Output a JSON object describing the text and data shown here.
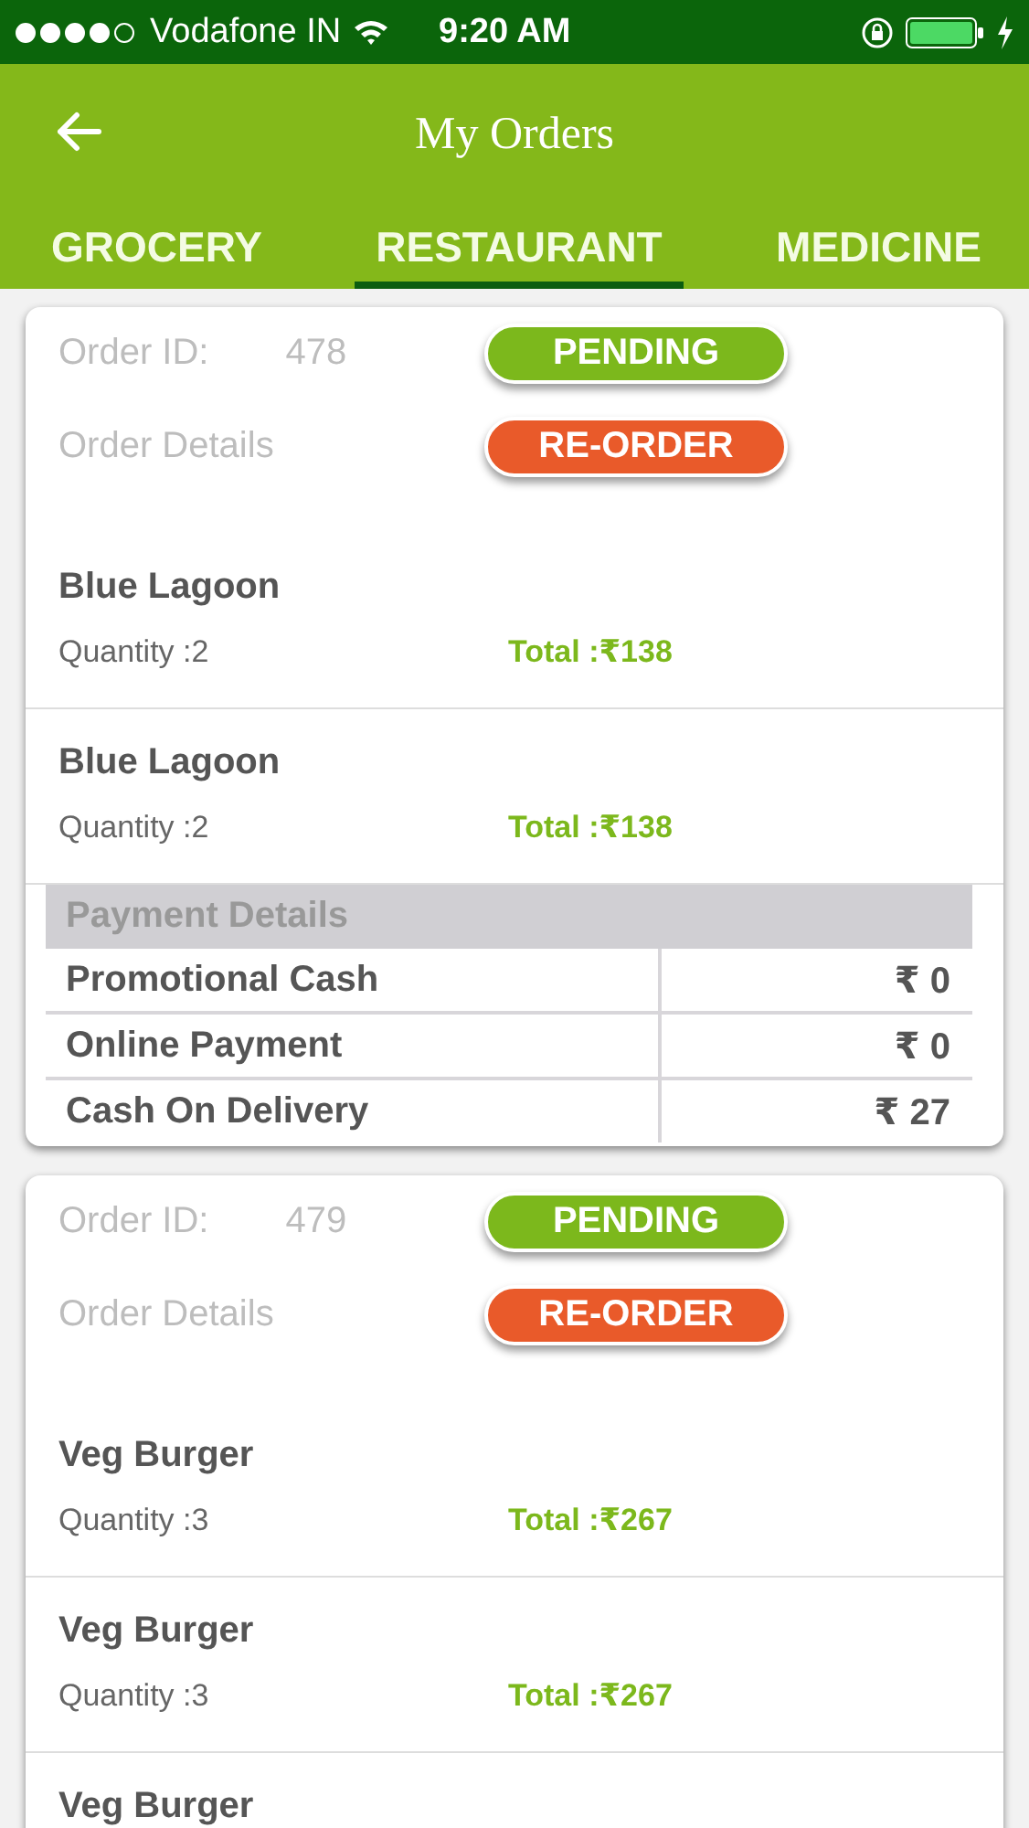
{
  "status_bar": {
    "carrier": "Vodafone IN",
    "time": "9:20 AM"
  },
  "header": {
    "title": "My Orders"
  },
  "tabs": [
    {
      "label": "GROCERY",
      "selected": false
    },
    {
      "label": "RESTAURANT",
      "selected": true
    },
    {
      "label": "MEDICINE",
      "selected": false
    }
  ],
  "orders": [
    {
      "id_label": "Order ID:",
      "id": "478",
      "status": "PENDING",
      "details_label": "Order Details",
      "reorder": "RE-ORDER",
      "items": [
        {
          "name": "Blue Lagoon",
          "quantity": "Quantity :2",
          "total": "Total :₹138"
        },
        {
          "name": "Blue Lagoon",
          "quantity": "Quantity :2",
          "total": "Total :₹138"
        }
      ],
      "payment": {
        "title": "Payment Details",
        "rows": [
          {
            "label": "Promotional Cash",
            "amount": "₹ 0"
          },
          {
            "label": "Online Payment",
            "amount": "₹ 0"
          },
          {
            "label": "Cash On Delivery",
            "amount": "₹ 27"
          }
        ]
      }
    },
    {
      "id_label": "Order ID:",
      "id": "479",
      "status": "PENDING",
      "details_label": "Order Details",
      "reorder": "RE-ORDER",
      "items": [
        {
          "name": "Veg Burger",
          "quantity": "Quantity :3",
          "total": "Total :₹267"
        },
        {
          "name": "Veg Burger",
          "quantity": "Quantity :3",
          "total": "Total :₹267"
        },
        {
          "name": "Veg Burger"
        }
      ]
    }
  ]
}
